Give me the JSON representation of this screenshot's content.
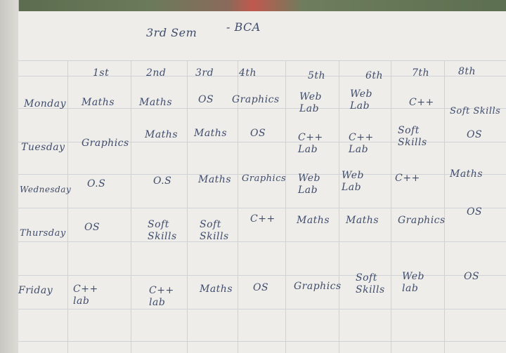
{
  "title": "3rd Sem",
  "subtitle": "- BCA",
  "periods": [
    "1st",
    "2nd",
    "3rd",
    "4th",
    "5th",
    "6th",
    "7th",
    "8th"
  ],
  "rows": [
    {
      "day": "Monday",
      "cells": [
        "Maths",
        "Maths",
        "OS",
        "Graphics",
        "Web\nLab",
        "Web\nLab",
        "C++",
        "Soft Skills"
      ]
    },
    {
      "day": "Tuesday",
      "cells": [
        "Graphics",
        "Maths",
        "Maths",
        "OS",
        "C++\nLab",
        "C++\nLab",
        "Soft\nSkills",
        "OS"
      ]
    },
    {
      "day": "Wednesday",
      "cells": [
        "O.S",
        "O.S",
        "Maths",
        "Graphics",
        "Web\nLab",
        "Web\nLab",
        "C++",
        "Maths"
      ]
    },
    {
      "day": "Thursday",
      "cells": [
        "OS",
        "Soft\nSkills",
        "Soft\nSkills",
        "C++",
        "Maths",
        "Maths",
        "Graphics",
        "OS"
      ]
    },
    {
      "day": "Friday",
      "cells": [
        "C++\nlab",
        "C++\nlab",
        "Maths",
        "OS",
        "Graphics",
        "Soft\nSkills",
        "Web\nlab",
        "OS"
      ]
    }
  ]
}
